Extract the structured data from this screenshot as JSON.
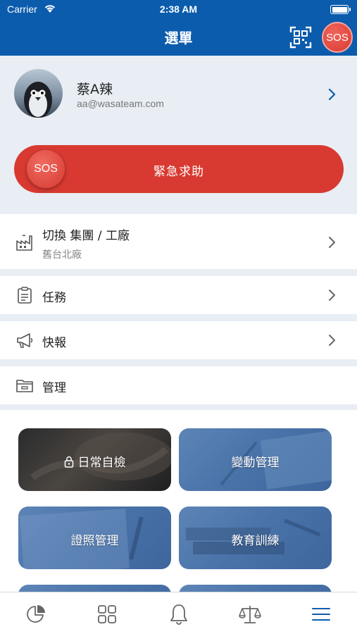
{
  "status_bar": {
    "carrier": "Carrier",
    "time": "2:38 AM"
  },
  "header": {
    "title": "選單",
    "sos_label": "SOS",
    "qr_icon": "qr-scan-icon"
  },
  "profile": {
    "name": "蔡A辣",
    "email": "aa@wasateam.com",
    "avatar_icon": "penguin-avatar"
  },
  "sos_bar": {
    "circle_label": "SOS",
    "label": "緊急求助"
  },
  "menu": {
    "switch": {
      "label": "切換 集團 / 工廠",
      "sub": "舊台北廠",
      "icon": "factory-icon"
    },
    "tasks": {
      "label": "任務",
      "icon": "clipboard-icon"
    },
    "news": {
      "label": "快報",
      "icon": "megaphone-icon"
    },
    "manage": {
      "label": "管理",
      "icon": "folder-icon"
    }
  },
  "tiles": [
    {
      "label": "日常自檢",
      "icon": "lock-icon"
    },
    {
      "label": "變動管理"
    },
    {
      "label": "證照管理"
    },
    {
      "label": "教育訓練"
    }
  ],
  "tabbar": [
    {
      "icon": "pie-chart-icon"
    },
    {
      "icon": "grid-icon"
    },
    {
      "icon": "bell-icon"
    },
    {
      "icon": "scale-icon"
    },
    {
      "icon": "menu-icon",
      "active": true
    }
  ],
  "colors": {
    "brand": "#0b5cad",
    "sos": "#d83a31",
    "tile_blue": "#4872a8"
  }
}
